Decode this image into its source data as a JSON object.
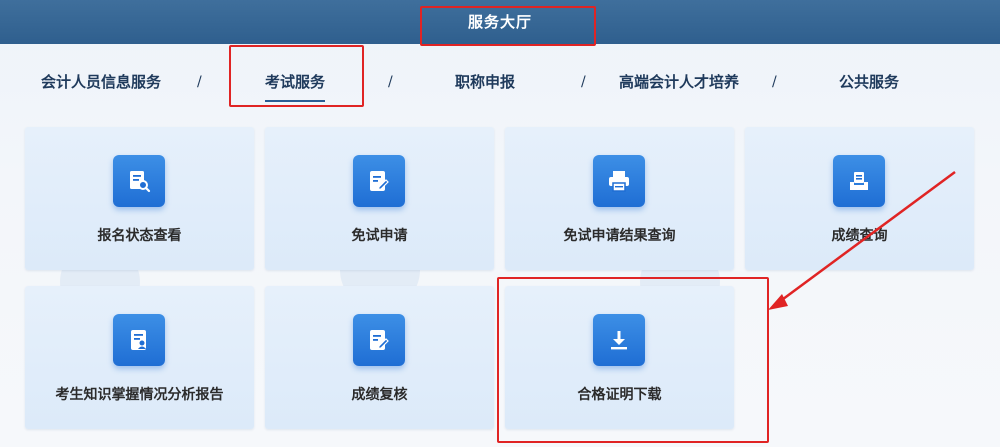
{
  "header": {
    "title": "服务大厅"
  },
  "nav": {
    "separator": "/",
    "items": [
      {
        "label": "会计人员信息服务"
      },
      {
        "label": "考试服务"
      },
      {
        "label": "职称申报"
      },
      {
        "label": "高端会计人才培养"
      },
      {
        "label": "公共服务"
      }
    ]
  },
  "cards": [
    {
      "label": "报名状态查看",
      "icon": "document-search-icon"
    },
    {
      "label": "免试申请",
      "icon": "edit-document-icon"
    },
    {
      "label": "免试申请结果查询",
      "icon": "printer-icon"
    },
    {
      "label": "成绩查询",
      "icon": "tray-icon"
    },
    {
      "label": "考生知识掌握情况分析报告",
      "icon": "report-user-icon"
    },
    {
      "label": "成绩复核",
      "icon": "edit-document-icon"
    },
    {
      "label": "合格证明下载",
      "icon": "download-icon"
    }
  ],
  "colors": {
    "header_bg": "#2f5f8e",
    "icon_blue": "#1f6ed4",
    "card_bg": "#e2edfa",
    "annotation_red": "#e02424"
  }
}
